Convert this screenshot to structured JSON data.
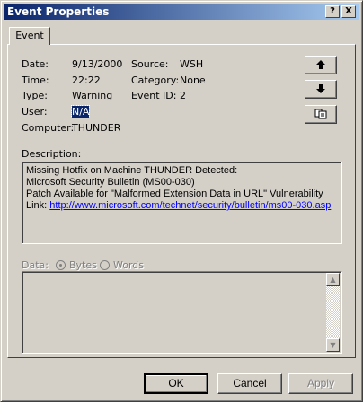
{
  "window": {
    "title": "Event Properties",
    "help_button": "?",
    "close_button": "X"
  },
  "tabs": [
    {
      "label": "Event"
    }
  ],
  "fields": {
    "date_label": "Date:",
    "date_value": "9/13/2000",
    "time_label": "Time:",
    "time_value": "22:22",
    "type_label": "Type:",
    "type_value": "Warning",
    "user_label": "User:",
    "user_value": "N/A",
    "computer_label": "Computer:",
    "computer_value": "THUNDER",
    "source_label": "Source:",
    "source_value": "WSH",
    "category_label": "Category:",
    "category_value": "None",
    "eventid_label": "Event ID:",
    "eventid_value": "2"
  },
  "nav_buttons": {
    "up_icon": "up-arrow-icon",
    "down_icon": "down-arrow-icon",
    "copy_icon": "copy-icon"
  },
  "description": {
    "label": "Description:",
    "lines": [
      "Missing Hotfix on Machine THUNDER Detected:",
      "Microsoft Security Bulletin (MS00-030)",
      "Patch Available for \"Malformed Extension Data in URL\" Vulnerability"
    ],
    "link_prefix": "Link: ",
    "link_text": "http://www.microsoft.com/technet/security/bulletin/ms00-030.asp"
  },
  "data_section": {
    "label": "Data:",
    "bytes_option": "Bytes",
    "words_option": "Words",
    "selected": "Bytes"
  },
  "buttons": {
    "ok": "OK",
    "cancel": "Cancel",
    "apply": "Apply"
  },
  "colors": {
    "face": "#d4d0c8",
    "title_start": "#0a246a",
    "title_end": "#a6caf0",
    "link": "#0000ff"
  }
}
